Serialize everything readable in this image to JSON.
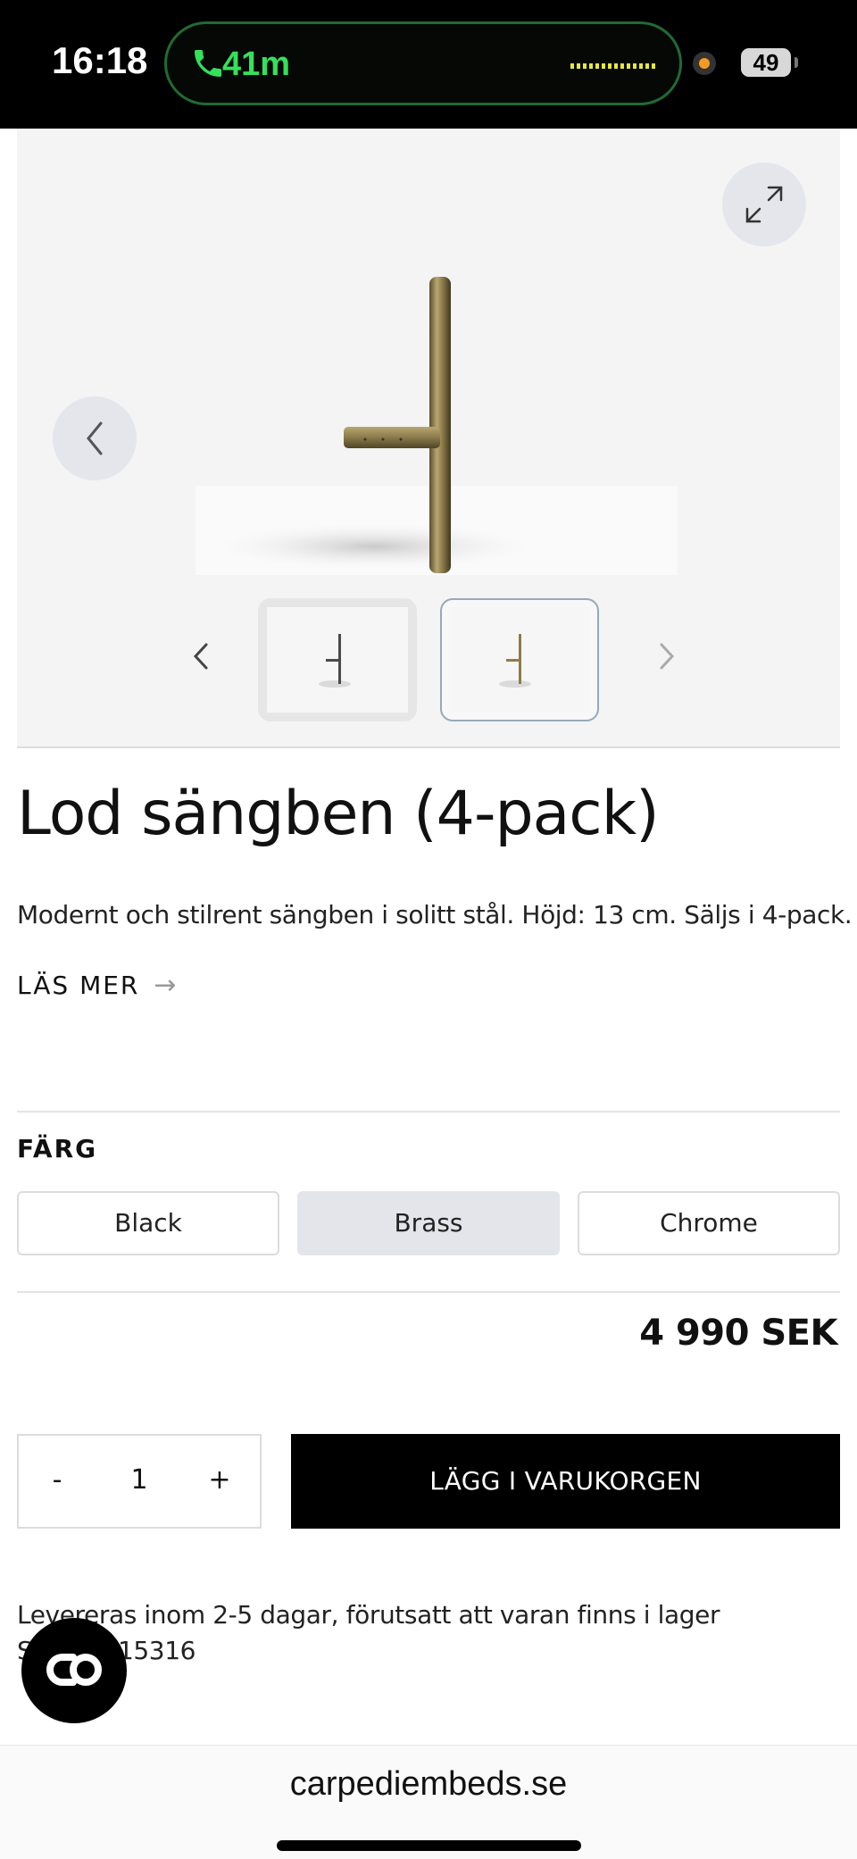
{
  "status_bar": {
    "time": "16:18",
    "call_duration": "41m",
    "battery": "49"
  },
  "gallery": {
    "icons": {
      "expand": "expand-icon",
      "prev": "chevron-left-icon",
      "thumb_prev": "chevron-left-icon",
      "thumb_next": "chevron-right-icon"
    },
    "selected_thumbnail": 2,
    "thumbnail_count": 2
  },
  "product": {
    "title": "Lod sängben (4-pack)",
    "description": "Modernt och stilrent sängben i solitt stål. Höjd: 13 cm. Säljs i 4-pack.",
    "read_more": "LÄS MER",
    "color_label": "FÄRG",
    "color_options": [
      {
        "label": "Black",
        "selected": false
      },
      {
        "label": "Brass",
        "selected": true
      },
      {
        "label": "Chrome",
        "selected": false
      }
    ],
    "price": "4 990 SEK"
  },
  "purchase": {
    "minus": "-",
    "quantity": "1",
    "plus": "+",
    "add_to_cart": "LÄGG I VARUKORGEN"
  },
  "info": {
    "delivery": "Levereras inom 2-5 dagar, förutsatt att varan finns i lager",
    "sku": "S        2791415316"
  },
  "colors": {
    "accent_selected": "#e4e5ea",
    "cart_button": "#000000",
    "call_green": "#35e05a"
  },
  "browser": {
    "url": "carpediembeds.se"
  }
}
